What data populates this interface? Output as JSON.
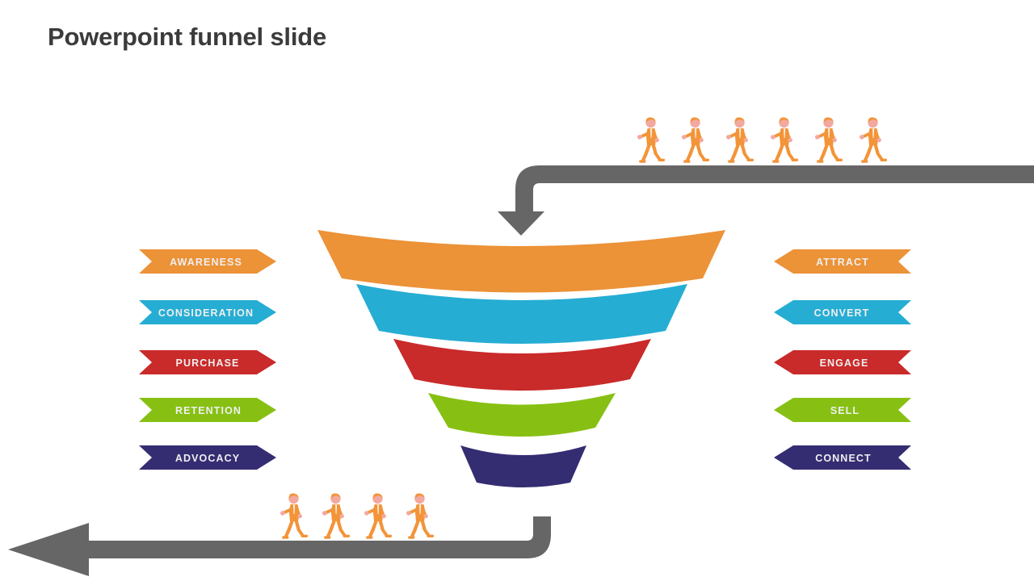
{
  "slide": {
    "title": "Powerpoint funnel slide",
    "title_color": "#3b3b3b",
    "background": "#ffffff"
  },
  "palette": {
    "orange": "#ec9237",
    "blue": "#26add3",
    "red": "#c92a2a",
    "green": "#87c013",
    "navy": "#352d72",
    "gray_arrow": "#666666",
    "label_text": "#efefef",
    "figure_body": "#f39439",
    "figure_skin": "#f2a9a0"
  },
  "left_labels": [
    {
      "label": "AWARENESS",
      "color": "#ec9237",
      "icon": "chevron-right-banner"
    },
    {
      "label": "CONSIDERATION",
      "color": "#26add3",
      "icon": "chevron-right-banner"
    },
    {
      "label": "PURCHASE",
      "color": "#c92a2a",
      "icon": "chevron-right-banner"
    },
    {
      "label": "RETENTION",
      "color": "#87c013",
      "icon": "chevron-right-banner"
    },
    {
      "label": "ADVOCACY",
      "color": "#352d72",
      "icon": "chevron-right-banner"
    }
  ],
  "right_labels": [
    {
      "label": "ATTRACT",
      "color": "#ec9237",
      "icon": "chevron-left-banner"
    },
    {
      "label": "CONVERT",
      "color": "#26add3",
      "icon": "chevron-left-banner"
    },
    {
      "label": "ENGAGE",
      "color": "#c92a2a",
      "icon": "chevron-left-banner"
    },
    {
      "label": "SELL",
      "color": "#87c013",
      "icon": "chevron-left-banner"
    },
    {
      "label": "CONNECT",
      "color": "#352d72",
      "icon": "chevron-left-banner"
    }
  ],
  "funnel": {
    "layers": [
      {
        "name": "awareness-layer",
        "color": "#ec9237"
      },
      {
        "name": "consideration-layer",
        "color": "#26add3"
      },
      {
        "name": "purchase-layer",
        "color": "#c92a2a"
      },
      {
        "name": "retention-layer",
        "color": "#87c013"
      },
      {
        "name": "advocacy-layer",
        "color": "#352d72"
      }
    ]
  },
  "flow": {
    "inbound_arrow": {
      "name": "inbound-arrow",
      "direction": "down",
      "color": "#666666"
    },
    "outbound_arrow": {
      "name": "outbound-arrow",
      "direction": "left",
      "color": "#666666"
    },
    "inbound_people_count": 6,
    "outbound_people_count": 4
  },
  "chart_data": {
    "type": "funnel",
    "title": "Powerpoint funnel slide",
    "stages": [
      {
        "stage": "AWARENESS",
        "action": "ATTRACT",
        "color": "#ec9237",
        "relative_width": 100
      },
      {
        "stage": "CONSIDERATION",
        "action": "CONVERT",
        "color": "#26add3",
        "relative_width": 82
      },
      {
        "stage": "PURCHASE",
        "action": "ENGAGE",
        "color": "#c92a2a",
        "relative_width": 62
      },
      {
        "stage": "RETENTION",
        "action": "SELL",
        "color": "#87c013",
        "relative_width": 43
      },
      {
        "stage": "ADVOCACY",
        "action": "CONNECT",
        "color": "#352d72",
        "relative_width": 25
      }
    ],
    "entering_people": 6,
    "exiting_people": 4,
    "legend": "none",
    "grid": false
  }
}
